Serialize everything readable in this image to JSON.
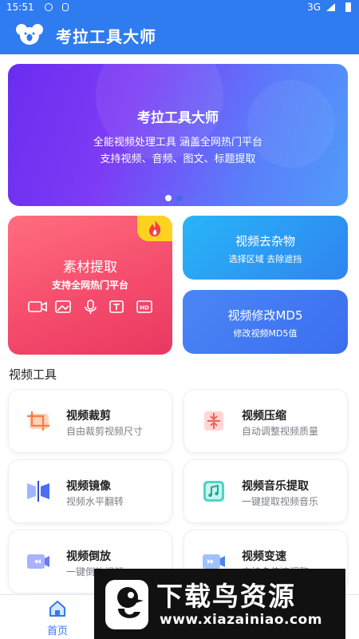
{
  "status_bar": {
    "time": "15:51",
    "network": "3G"
  },
  "app": {
    "title": "考拉工具大师"
  },
  "banner": {
    "title": "考拉工具大师",
    "line1": "全能视频处理工具 涵盖全网热门平台",
    "line2": "支持视频、音频、图文、标题提取",
    "page_index": 1,
    "page_count": 2
  },
  "feature_cards": {
    "material": {
      "title": "素材提取",
      "subtitle": "支持全网热门平台"
    },
    "remove_objects": {
      "title": "视频去杂物",
      "subtitle": "选择区域 去除遮挡"
    },
    "modify_md5": {
      "title": "视频修改MD5",
      "subtitle": "修改视频MD5值"
    }
  },
  "section": {
    "title": "视频工具"
  },
  "tools": [
    {
      "title": "视频裁剪",
      "subtitle": "自由裁剪视频尺寸",
      "icon": "crop-icon"
    },
    {
      "title": "视频压缩",
      "subtitle": "自动调整视频质量",
      "icon": "compress-icon"
    },
    {
      "title": "视频镜像",
      "subtitle": "视频水平翻转",
      "icon": "mirror-icon"
    },
    {
      "title": "视频音乐提取",
      "subtitle": "一键提取视频音乐",
      "icon": "music-icon"
    },
    {
      "title": "视频倒放",
      "subtitle": "一键倒放视频",
      "icon": "rewind-icon"
    },
    {
      "title": "视频变速",
      "subtitle": "支持多倍速调整",
      "icon": "speed-icon"
    }
  ],
  "bottom_nav": {
    "home": "首页"
  },
  "watermark": {
    "title": "下载鸟资源",
    "url": "www.xiazainiao.com"
  },
  "colors": {
    "primary": "#2f7bf0",
    "red_card": "#f54c6c",
    "blue_card": "#2f84f0",
    "banner": "#6a2cf0"
  }
}
